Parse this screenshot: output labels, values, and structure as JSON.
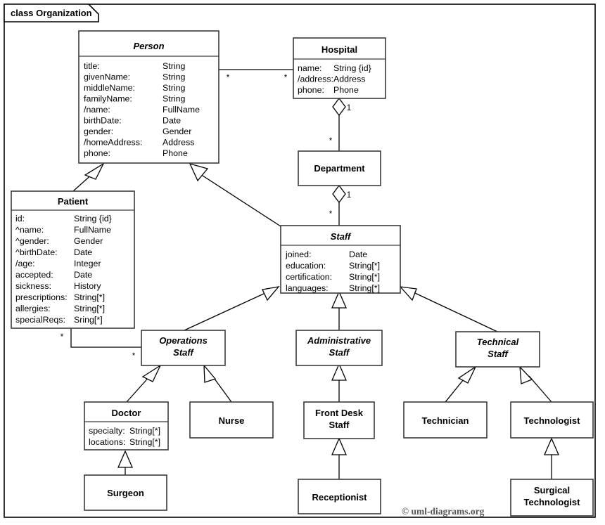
{
  "frame": {
    "label": "class Organization",
    "kind": "class-diagram-frame"
  },
  "copyright": "© uml-diagrams.org",
  "classes": {
    "person": {
      "name": "Person",
      "abstract": true,
      "attributes": [
        {
          "name": "title:",
          "type": "String"
        },
        {
          "name": "givenName:",
          "type": "String"
        },
        {
          "name": "middleName:",
          "type": "String"
        },
        {
          "name": "familyName:",
          "type": "String"
        },
        {
          "name": "/name:",
          "type": "FullName"
        },
        {
          "name": "birthDate:",
          "type": "Date"
        },
        {
          "name": "gender:",
          "type": "Gender"
        },
        {
          "name": "/homeAddress:",
          "type": "Address"
        },
        {
          "name": "phone:",
          "type": "Phone"
        }
      ]
    },
    "hospital": {
      "name": "Hospital",
      "abstract": false,
      "attributes": [
        {
          "name": "name:",
          "type": "String {id}"
        },
        {
          "name": "/address:",
          "type": "Address"
        },
        {
          "name": "phone:",
          "type": "Phone"
        }
      ]
    },
    "patient": {
      "name": "Patient",
      "abstract": false,
      "attributes": [
        {
          "name": "id:",
          "type": "String {id}"
        },
        {
          "name": "^name:",
          "type": "FullName"
        },
        {
          "name": "^gender:",
          "type": "Gender"
        },
        {
          "name": "^birthDate:",
          "type": "Date"
        },
        {
          "name": "/age:",
          "type": "Integer"
        },
        {
          "name": "accepted:",
          "type": "Date"
        },
        {
          "name": "sickness:",
          "type": "History"
        },
        {
          "name": "prescriptions:",
          "type": "String[*]"
        },
        {
          "name": "allergies:",
          "type": "String[*]"
        },
        {
          "name": "specialReqs:",
          "type": "Sring[*]"
        }
      ]
    },
    "department": {
      "name": "Department",
      "abstract": false,
      "attributes": []
    },
    "staff": {
      "name": "Staff",
      "abstract": true,
      "attributes": [
        {
          "name": "joined:",
          "type": "Date"
        },
        {
          "name": "education:",
          "type": "String[*]"
        },
        {
          "name": "certification:",
          "type": "String[*]"
        },
        {
          "name": "languages:",
          "type": "String[*]"
        }
      ]
    },
    "operations_staff": {
      "name": "Operations Staff",
      "name_lines": [
        "Operations",
        "Staff"
      ],
      "abstract": true,
      "attributes": []
    },
    "administrative_staff": {
      "name": "Administrative Staff",
      "name_lines": [
        "Administrative",
        "Staff"
      ],
      "abstract": true,
      "attributes": []
    },
    "technical_staff": {
      "name": "Technical Staff",
      "name_lines": [
        "Technical",
        "Staff"
      ],
      "abstract": true,
      "attributes": []
    },
    "doctor": {
      "name": "Doctor",
      "abstract": false,
      "attributes": [
        {
          "name": "specialty:",
          "type": "String[*]"
        },
        {
          "name": "locations:",
          "type": "String[*]"
        }
      ]
    },
    "nurse": {
      "name": "Nurse",
      "abstract": false,
      "attributes": []
    },
    "front_desk_staff": {
      "name": "Front Desk Staff",
      "name_lines": [
        "Front Desk",
        "Staff"
      ],
      "abstract": false,
      "attributes": []
    },
    "technician": {
      "name": "Technician",
      "abstract": false,
      "attributes": []
    },
    "technologist": {
      "name": "Technologist",
      "abstract": false,
      "attributes": []
    },
    "surgeon": {
      "name": "Surgeon",
      "abstract": false,
      "attributes": []
    },
    "receptionist": {
      "name": "Receptionist",
      "abstract": false,
      "attributes": []
    },
    "surgical_technologist": {
      "name": "Surgical Technologist",
      "name_lines": [
        "Surgical",
        "Technologist"
      ],
      "abstract": false,
      "attributes": []
    }
  },
  "relationships": [
    {
      "kind": "association",
      "from": "person",
      "to": "hospital",
      "from_multiplicity": "*",
      "to_multiplicity": "*"
    },
    {
      "kind": "aggregation",
      "whole": "hospital",
      "part": "department",
      "whole_multiplicity": "1",
      "part_multiplicity": "*"
    },
    {
      "kind": "aggregation",
      "whole": "department",
      "part": "staff",
      "whole_multiplicity": "1",
      "part_multiplicity": "*"
    },
    {
      "kind": "association",
      "from": "patient",
      "to": "operations_staff",
      "from_multiplicity": "*",
      "to_multiplicity": "*"
    },
    {
      "kind": "generalization",
      "child": "patient",
      "parent": "person"
    },
    {
      "kind": "generalization",
      "child": "staff",
      "parent": "person"
    },
    {
      "kind": "generalization",
      "child": "operations_staff",
      "parent": "staff"
    },
    {
      "kind": "generalization",
      "child": "administrative_staff",
      "parent": "staff"
    },
    {
      "kind": "generalization",
      "child": "technical_staff",
      "parent": "staff"
    },
    {
      "kind": "generalization",
      "child": "doctor",
      "parent": "operations_staff"
    },
    {
      "kind": "generalization",
      "child": "nurse",
      "parent": "operations_staff"
    },
    {
      "kind": "generalization",
      "child": "front_desk_staff",
      "parent": "administrative_staff"
    },
    {
      "kind": "generalization",
      "child": "technician",
      "parent": "technical_staff"
    },
    {
      "kind": "generalization",
      "child": "technologist",
      "parent": "technical_staff"
    },
    {
      "kind": "generalization",
      "child": "surgeon",
      "parent": "doctor"
    },
    {
      "kind": "generalization",
      "child": "receptionist",
      "parent": "front_desk_staff"
    },
    {
      "kind": "generalization",
      "child": "surgical_technologist",
      "parent": "technologist"
    }
  ],
  "multiplicity_labels": {
    "person_hospital_left": "*",
    "person_hospital_right": "*",
    "hospital_department_top": "1",
    "hospital_department_bottom": "*",
    "department_staff_top": "1",
    "department_staff_bottom": "*",
    "patient_ops_left": "*",
    "patient_ops_right": "*"
  }
}
